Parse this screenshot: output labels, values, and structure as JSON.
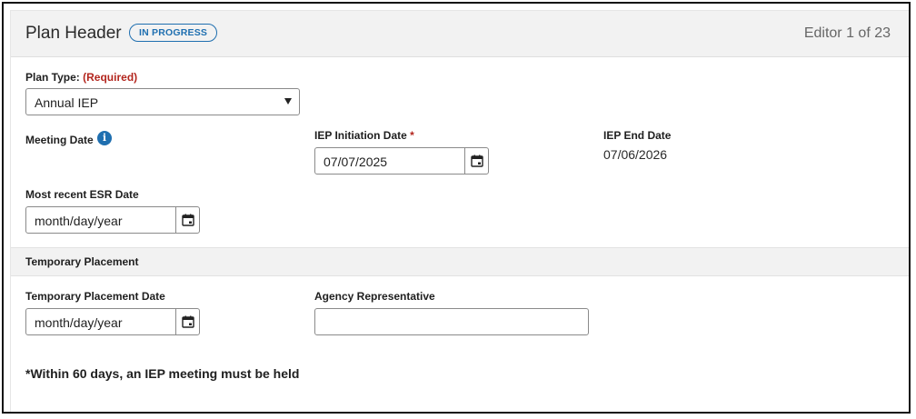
{
  "header": {
    "title": "Plan Header",
    "status_badge": "IN PROGRESS",
    "editor_count": "Editor 1 of 23"
  },
  "plan_type": {
    "label": "Plan Type:",
    "required_text": "(Required)",
    "selected_value": "Annual IEP"
  },
  "meeting_date": {
    "label": "Meeting Date",
    "info_icon": "info-icon"
  },
  "iep_initiation_date": {
    "label": "IEP Initiation Date",
    "required_marker": "*",
    "value": "07/07/2025"
  },
  "iep_end_date": {
    "label": "IEP End Date",
    "value": "07/06/2026"
  },
  "esr_date": {
    "label": "Most recent ESR Date",
    "placeholder": "month/day/year"
  },
  "temporary_placement_section": {
    "title": "Temporary Placement"
  },
  "temporary_placement_date": {
    "label": "Temporary Placement Date",
    "placeholder": "month/day/year"
  },
  "agency_representative": {
    "label": "Agency Representative",
    "value": ""
  },
  "note": "*Within 60 days, an IEP meeting must be held",
  "colors": {
    "accent": "#1f6fb0",
    "required": "#b3261e",
    "header_bg": "#f2f2f2"
  },
  "icons": {
    "calendar": "calendar-icon",
    "dropdown": "chevron-down-icon",
    "info": "info-icon"
  }
}
